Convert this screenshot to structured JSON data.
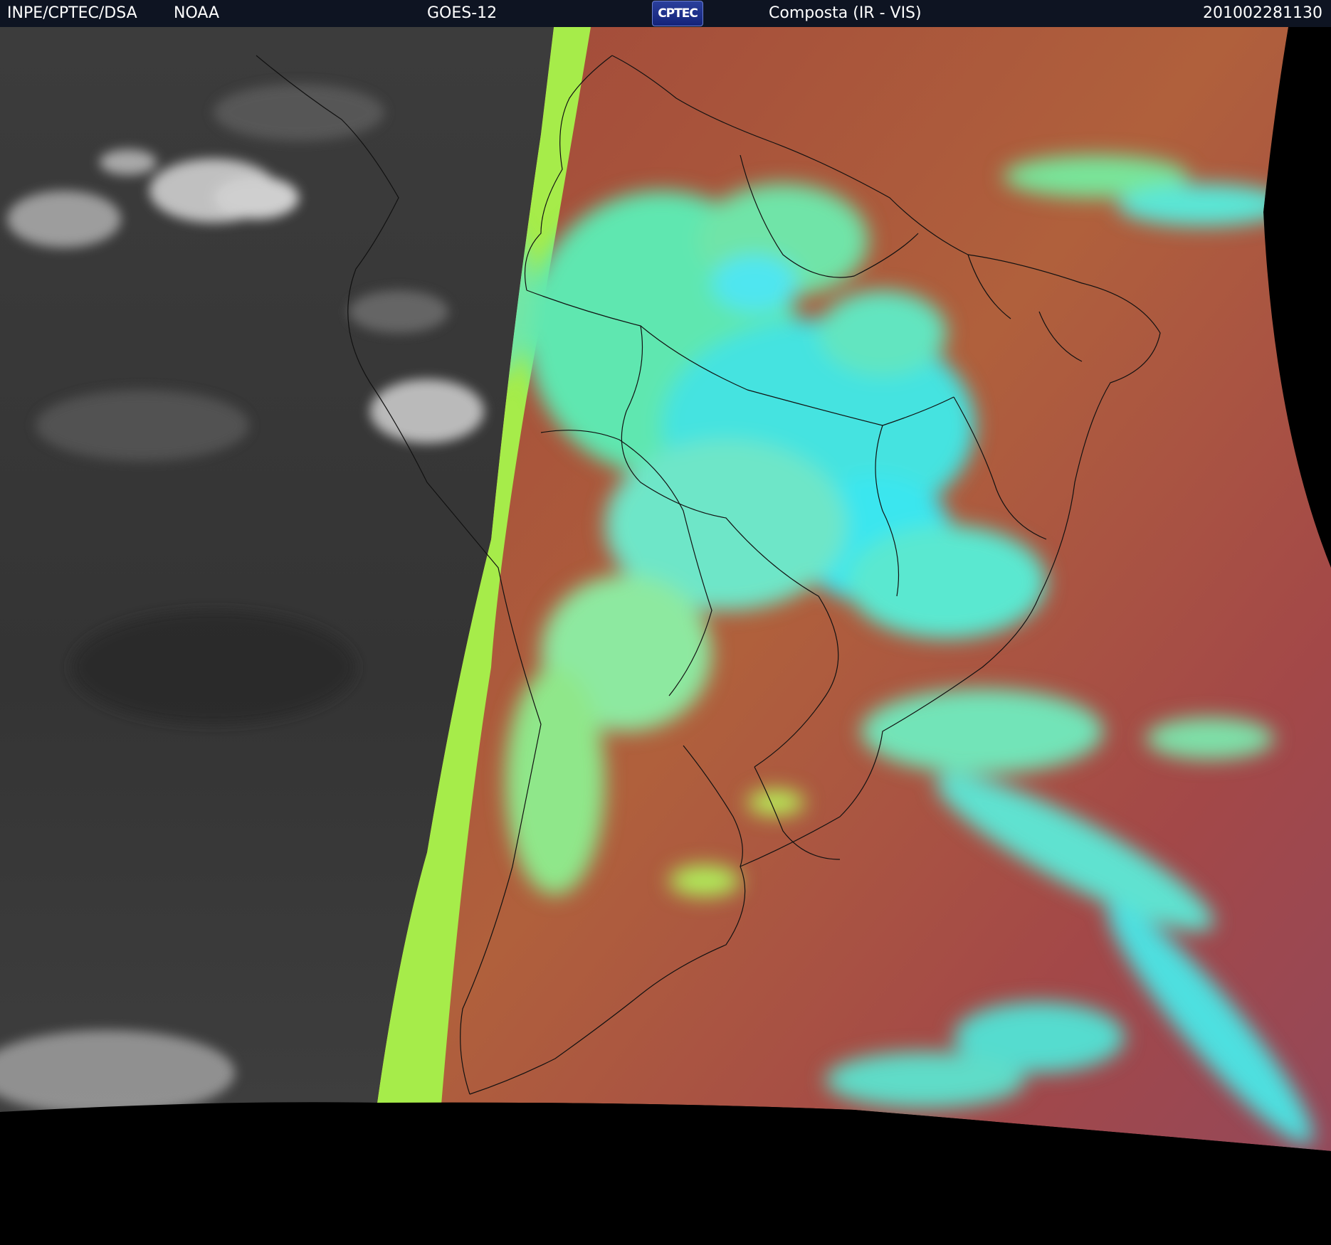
{
  "header": {
    "org": "INPE/CPTEC/DSA",
    "agency": "NOAA",
    "satellite": "GOES-12",
    "logo_text": "CPTEC",
    "product": "Composta (IR - VIS)",
    "timestamp": "201002281130"
  },
  "colors": {
    "header_bg": "#0e1422",
    "space": "#000000",
    "ir_ocean": "#3a3a3a",
    "ir_cloud": "#d8d8d8",
    "vis_land_red": "#a2463b",
    "vis_ocean_orange": "#b46a3c",
    "vis_ocean_magenta": "#9a4a5a",
    "cloud_cyan": "#45e3e0",
    "cloud_green": "#8fe75a",
    "terminator_green": "#a6ec4a",
    "borders": "#111111"
  }
}
